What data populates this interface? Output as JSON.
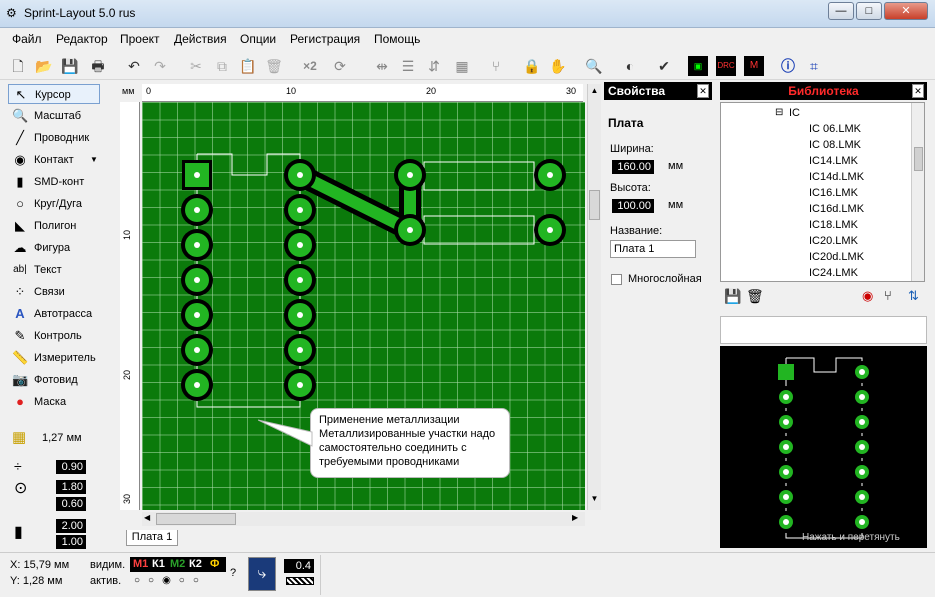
{
  "window": {
    "title": "Sprint-Layout 5.0 rus",
    "minimize": "—",
    "maximize": "□",
    "close": "✕"
  },
  "menu": [
    "Файл",
    "Редактор",
    "Проект",
    "Действия",
    "Опции",
    "Регистрация",
    "Помощь"
  ],
  "toolbar": {
    "x2_label": "×2"
  },
  "tools": [
    {
      "label": "Курсор",
      "icon": "cursor-icon"
    },
    {
      "label": "Масштаб",
      "icon": "zoom-icon"
    },
    {
      "label": "Проводник",
      "icon": "track-icon"
    },
    {
      "label": "Контакт",
      "icon": "pad-icon"
    },
    {
      "label": "SMD-конт",
      "icon": "smd-icon"
    },
    {
      "label": "Круг/Дуга",
      "icon": "circle-icon"
    },
    {
      "label": "Полигон",
      "icon": "polygon-icon"
    },
    {
      "label": "Фигура",
      "icon": "shape-icon"
    },
    {
      "label": "Текст",
      "icon": "text-icon"
    },
    {
      "label": "Связи",
      "icon": "connections-icon"
    },
    {
      "label": "Автотрасса",
      "icon": "autoroute-icon"
    },
    {
      "label": "Контроль",
      "icon": "control-icon"
    },
    {
      "label": "Измеритель",
      "icon": "measure-icon"
    },
    {
      "label": "Фотовид",
      "icon": "photo-icon"
    },
    {
      "label": "Маска",
      "icon": "mask-icon"
    }
  ],
  "grid": {
    "value": "1,27 мм"
  },
  "params": {
    "track": "0.90",
    "pad_outer": "1.80",
    "pad_inner": "0.60",
    "smd_w": "2.00",
    "smd_h": "1.00"
  },
  "ruler": {
    "unit": "мм",
    "top_ticks": [
      "0",
      "10",
      "20",
      "30"
    ],
    "left_ticks": [
      "10",
      "20",
      "30"
    ]
  },
  "callout": {
    "text": "Применение металлизации Металлизированные участки надо самостоятельно соединить с требуемыми проводниками"
  },
  "tab": {
    "label": "Плата 1"
  },
  "properties": {
    "title": "Свойства",
    "section": "Плата",
    "width_label": "Ширина:",
    "width_value": "160.00",
    "height_label": "Высота:",
    "height_value": "100.00",
    "unit": "мм",
    "name_label": "Название:",
    "name_value": "Плата 1",
    "multilayer_label": "Многослойная"
  },
  "library": {
    "title": "Библиотека",
    "root": "IC",
    "items": [
      "IC 06.LMK",
      "IC 08.LMK",
      "IC14.LMK",
      "IC14d.LMK",
      "IC16.LMK",
      "IC16d.LMK",
      "IC18.LMK",
      "IC20.LMK",
      "IC20d.LMK",
      "IC24.LMK"
    ],
    "drag_hint": "Нажать и перетянуть"
  },
  "status": {
    "x": "X:  15,79 мм",
    "y": "Y:   1,28 мм",
    "visible_label": "видим.",
    "active_label": "актив.",
    "layers": [
      "М1",
      "К1",
      "М2",
      "К2",
      "Ф"
    ],
    "layer_colors": [
      "#ff4040",
      "#ffffff",
      "#2aa02a",
      "#ffffff",
      "#ffd000"
    ],
    "question": "?",
    "trace_width": "0.4"
  },
  "colors": {
    "board": "#0b7a0b",
    "pad": "#22b522",
    "selection": "#ffffff"
  }
}
